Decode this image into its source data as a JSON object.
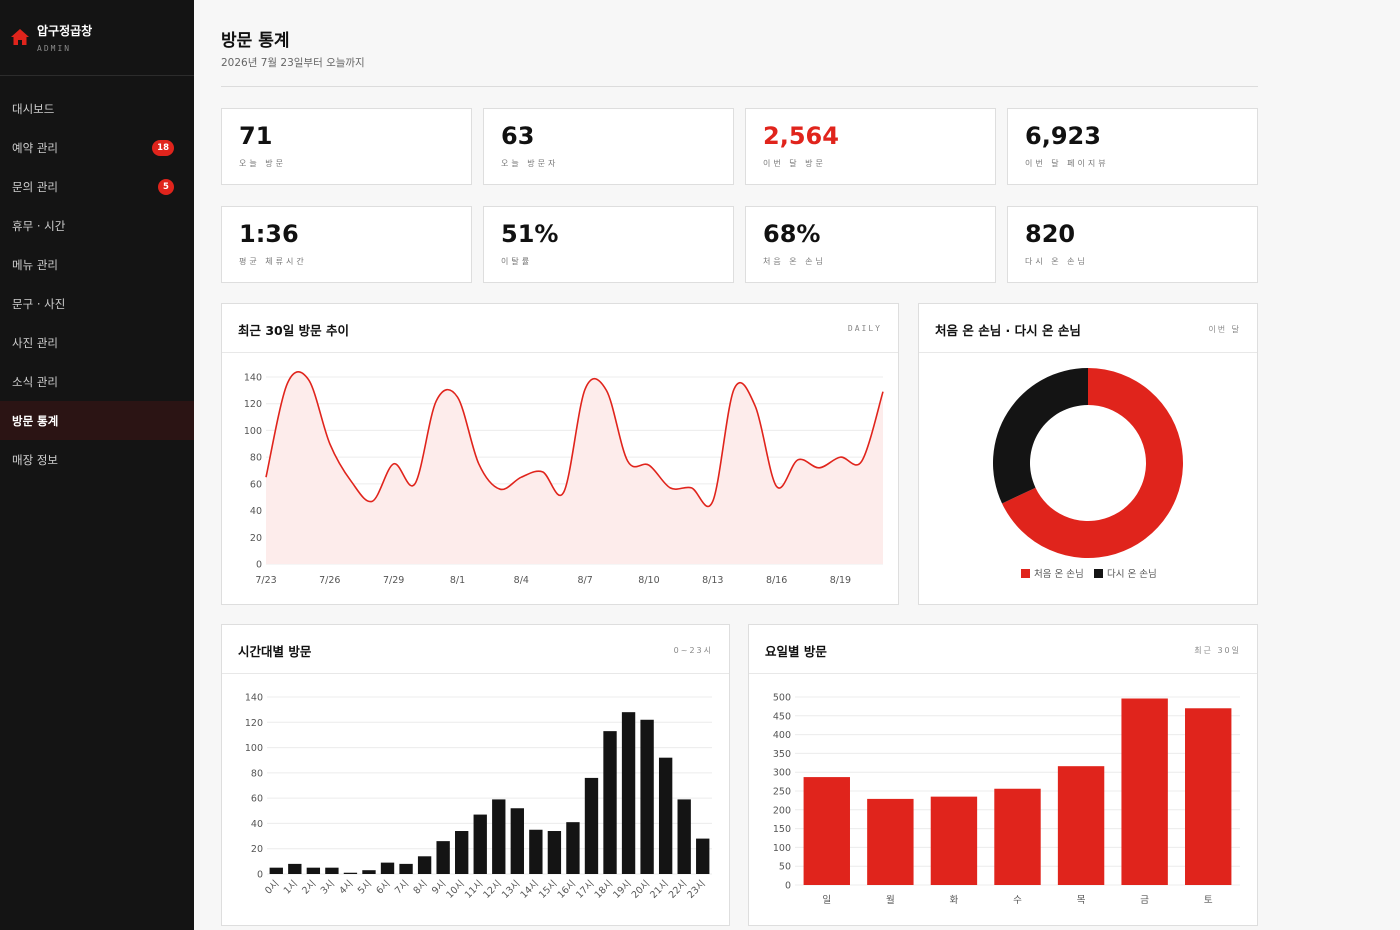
{
  "sidebar": {
    "brand_name": "압구정곱창",
    "brand_sub": "ADMIN",
    "items": [
      {
        "label": "대시보드",
        "badge": ""
      },
      {
        "label": "예약 관리",
        "badge": "18"
      },
      {
        "label": "문의 관리",
        "badge": "5"
      },
      {
        "label": "휴무 · 시간",
        "badge": ""
      },
      {
        "label": "메뉴 관리",
        "badge": ""
      },
      {
        "label": "문구 · 사진",
        "badge": ""
      },
      {
        "label": "사진 관리",
        "badge": ""
      },
      {
        "label": "소식 관리",
        "badge": ""
      },
      {
        "label": "방문 통계",
        "badge": ""
      },
      {
        "label": "매장 정보",
        "badge": ""
      }
    ],
    "active_index": 8
  },
  "header": {
    "title": "방문 통계",
    "subtitle": "2026년 7월 23일부터 오늘까지"
  },
  "kpis": [
    {
      "value": "71",
      "label": "오늘 방문"
    },
    {
      "value": "63",
      "label": "오늘 방문자"
    },
    {
      "value": "2,564",
      "label": "이번 달 방문"
    },
    {
      "value": "6,923",
      "label": "이번 달 페이지뷰"
    },
    {
      "value": "1:36",
      "label": "평균 체류시간"
    },
    {
      "value": "51%",
      "label": "이탈률"
    },
    {
      "value": "68%",
      "label": "처음 온 손님"
    },
    {
      "value": "820",
      "label": "다시 온 손님"
    }
  ],
  "colors": {
    "accent": "#e0241c",
    "dark": "#141414",
    "fill": "#fdeceb"
  },
  "cards": {
    "trend": {
      "title": "최근 30일 방문 추이",
      "tag": "DAILY"
    },
    "donut": {
      "title": "처음 온 손님 · 다시 온 손님",
      "tag": "이번 달"
    },
    "hourly": {
      "title": "시간대별 방문",
      "tag": "0~23시"
    },
    "weekday": {
      "title": "요일별 방문",
      "tag": "최근 30일"
    }
  },
  "chart_data": [
    {
      "type": "area",
      "title": "최근 30일 방문 추이",
      "x": [
        "7/23",
        "7/24",
        "7/25",
        "7/26",
        "7/27",
        "7/28",
        "7/29",
        "7/30",
        "7/31",
        "8/1",
        "8/2",
        "8/3",
        "8/4",
        "8/5",
        "8/6",
        "8/7",
        "8/8",
        "8/9",
        "8/10",
        "8/11",
        "8/12",
        "8/13",
        "8/14",
        "8/15",
        "8/16",
        "8/17",
        "8/18",
        "8/19",
        "8/20",
        "8/21"
      ],
      "xticks": [
        "7/23",
        "7/26",
        "7/29",
        "8/1",
        "8/4",
        "8/7",
        "8/10",
        "8/13",
        "8/16",
        "8/19"
      ],
      "values": [
        65,
        135,
        138,
        90,
        62,
        47,
        75,
        60,
        122,
        125,
        75,
        56,
        65,
        69,
        54,
        131,
        130,
        77,
        74,
        57,
        57,
        47,
        131,
        118,
        58,
        78,
        72,
        80,
        77,
        129
      ],
      "ylim": [
        0,
        140
      ],
      "yticks": [
        0,
        20,
        40,
        60,
        80,
        100,
        120,
        140
      ],
      "grid": true
    },
    {
      "type": "pie",
      "title": "처음 온 손님 · 다시 온 손님",
      "labels": [
        "처음 온 손님",
        "다시 온 손님"
      ],
      "values": [
        68,
        32
      ],
      "colors": [
        "#e0241c",
        "#141414"
      ],
      "legend": "bottom"
    },
    {
      "type": "bar",
      "title": "시간대별 방문",
      "categories": [
        "0시",
        "1시",
        "2시",
        "3시",
        "4시",
        "5시",
        "6시",
        "7시",
        "8시",
        "9시",
        "10시",
        "11시",
        "12시",
        "13시",
        "14시",
        "15시",
        "16시",
        "17시",
        "18시",
        "19시",
        "20시",
        "21시",
        "22시",
        "23시"
      ],
      "values": [
        5,
        8,
        5,
        5,
        1,
        3,
        9,
        8,
        14,
        26,
        34,
        47,
        59,
        52,
        35,
        34,
        41,
        76,
        113,
        128,
        122,
        92,
        59,
        28
      ],
      "ylim": [
        0,
        140
      ],
      "yticks": [
        0,
        20,
        40,
        60,
        80,
        100,
        120,
        140
      ],
      "color": "#141414",
      "grid": true
    },
    {
      "type": "bar",
      "title": "요일별 방문",
      "categories": [
        "일",
        "월",
        "화",
        "수",
        "목",
        "금",
        "토"
      ],
      "values": [
        287,
        229,
        235,
        256,
        316,
        496,
        470
      ],
      "ylim": [
        0,
        500
      ],
      "yticks": [
        0,
        50,
        100,
        150,
        200,
        250,
        300,
        350,
        400,
        450,
        500
      ],
      "color": "#e0241c",
      "grid": true
    }
  ]
}
